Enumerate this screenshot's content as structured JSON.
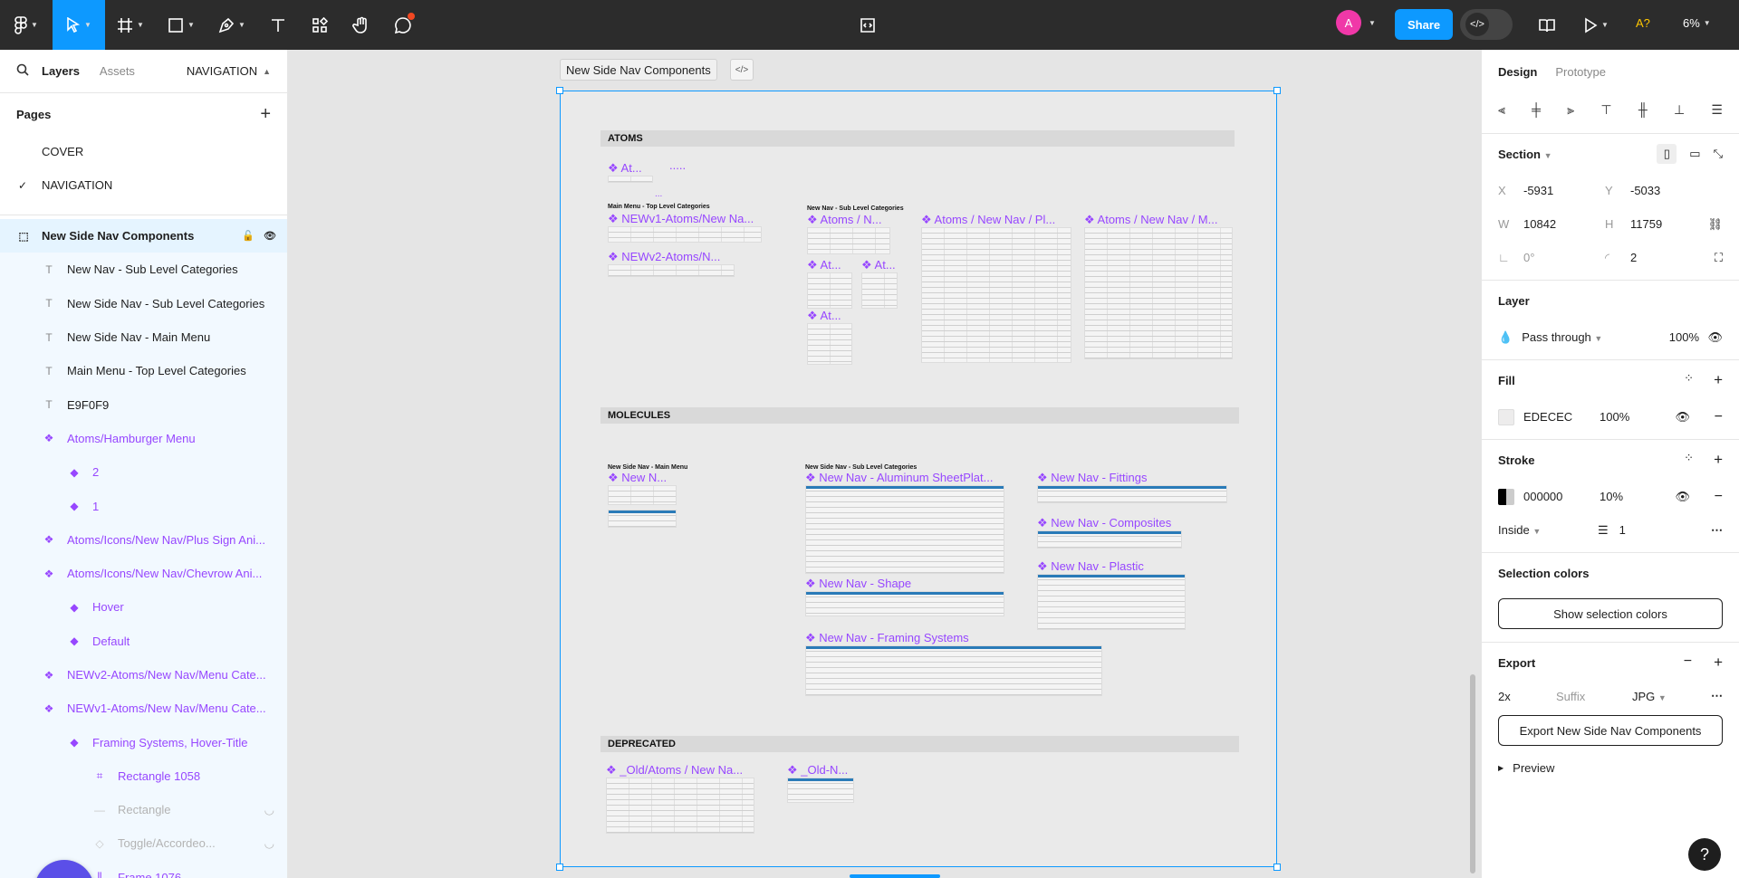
{
  "toolbar": {
    "avatar_letter": "A",
    "share_label": "Share",
    "alt_badge": "A?",
    "zoom": "6%",
    "accent": "#0d99ff"
  },
  "left_panel": {
    "tabs": {
      "layers": "Layers",
      "assets": "Assets"
    },
    "current_page_menu": "NAVIGATION",
    "pages_title": "Pages",
    "pages": [
      {
        "label": "COVER",
        "checked": false
      },
      {
        "label": "NAVIGATION",
        "checked": true
      }
    ],
    "layers": [
      {
        "label": "New Side Nav Components",
        "icon": "section",
        "indent": 0,
        "style": "selected"
      },
      {
        "label": "New Nav - Sub Level Categories",
        "icon": "text",
        "indent": 1,
        "style": "normal"
      },
      {
        "label": "New Side Nav - Sub Level Categories",
        "icon": "text",
        "indent": 1,
        "style": "normal"
      },
      {
        "label": "New Side Nav - Main Menu",
        "icon": "text",
        "indent": 1,
        "style": "normal"
      },
      {
        "label": "Main Menu - Top Level Categories",
        "icon": "text",
        "indent": 1,
        "style": "normal"
      },
      {
        "label": "E9F0F9",
        "icon": "text",
        "indent": 1,
        "style": "normal"
      },
      {
        "label": "Atoms/Hamburger Menu",
        "icon": "component",
        "indent": 1,
        "style": "purple"
      },
      {
        "label": "2",
        "icon": "variant",
        "indent": 2,
        "style": "purple"
      },
      {
        "label": "1",
        "icon": "variant",
        "indent": 2,
        "style": "purple"
      },
      {
        "label": "Atoms/Icons/New Nav/Plus Sign Ani...",
        "icon": "component",
        "indent": 1,
        "style": "purple"
      },
      {
        "label": "Atoms/Icons/New Nav/Chevrow Ani...",
        "icon": "component",
        "indent": 1,
        "style": "purple"
      },
      {
        "label": "Hover",
        "icon": "variant",
        "indent": 2,
        "style": "purple"
      },
      {
        "label": "Default",
        "icon": "variant",
        "indent": 2,
        "style": "purple"
      },
      {
        "label": "NEWv2-Atoms/New Nav/Menu Cate...",
        "icon": "component",
        "indent": 1,
        "style": "purple"
      },
      {
        "label": "NEWv1-Atoms/New Nav/Menu Cate...",
        "icon": "component",
        "indent": 1,
        "style": "purple"
      },
      {
        "label": "Framing Systems, Hover-Title",
        "icon": "variant",
        "indent": 2,
        "style": "purple"
      },
      {
        "label": "Rectangle 1058",
        "icon": "frame",
        "indent": 3,
        "style": "purple"
      },
      {
        "label": "Rectangle",
        "icon": "line",
        "indent": 3,
        "style": "faded"
      },
      {
        "label": "Toggle/Accordeo...",
        "icon": "instance",
        "indent": 3,
        "style": "faded"
      },
      {
        "label": "Frame 1076",
        "icon": "autolayout",
        "indent": 3,
        "style": "purple"
      }
    ]
  },
  "canvas": {
    "frame_label": "New Side Nav Components",
    "sections": {
      "atoms": "ATOMS",
      "molecules": "MOLECULES",
      "deprecated": "DEPRECATED"
    },
    "atoms": {
      "small_a": "❖ At...",
      "dots": ".....",
      "dots2": "...",
      "main_menu_caption": "Main Menu - Top Level Categories",
      "sub_level_caption": "New Nav - Sub Level Categories",
      "newv1": "❖ NEWv1-Atoms/New Na...",
      "newv2": "❖ NEWv2-Atoms/N...",
      "atoms_n": "❖ Atoms / N...",
      "at1": "❖ At...",
      "at2": "❖ At...",
      "at3": "❖ At...",
      "atoms_pl": "❖ Atoms / New Nav / Pl...",
      "atoms_m": "❖ Atoms / New Nav / M..."
    },
    "molecules": {
      "main_menu_caption": "New Side Nav - Main Menu",
      "sub_caption": "New Side Nav - Sub Level Categories",
      "new_n": "❖ New N...",
      "aluminum": "❖ New Nav - Aluminum SheetPlat...",
      "fittings": "❖ New Nav - Fittings",
      "composites": "❖ New Nav - Composites",
      "plastic": "❖ New Nav - Plastic",
      "shape": "❖ New Nav - Shape",
      "framing": "❖ New Nav - Framing Systems"
    },
    "deprecated": {
      "old_atoms": "❖ _Old/Atoms / New Na...",
      "old_n": "❖ _Old-N..."
    }
  },
  "right_panel": {
    "tabs": {
      "design": "Design",
      "prototype": "Prototype"
    },
    "section_title": "Section",
    "x_label": "X",
    "x": "-5931",
    "y_label": "Y",
    "y": "-5033",
    "w_label": "W",
    "w": "10842",
    "h_label": "H",
    "h": "11759",
    "rotation": "0°",
    "radius": "2",
    "layer_title": "Layer",
    "blend": "Pass through",
    "opacity": "100%",
    "fill_title": "Fill",
    "fill_hex": "EDECEC",
    "fill_color": "#edecec",
    "fill_opacity": "100%",
    "stroke_title": "Stroke",
    "stroke_hex": "000000",
    "stroke_opacity": "10%",
    "stroke_position": "Inside",
    "stroke_weight": "1",
    "selection_colors_title": "Selection colors",
    "show_selection_colors": "Show selection colors",
    "export_title": "Export",
    "export_scale": "2x",
    "export_suffix_placeholder": "Suffix",
    "export_format": "JPG",
    "export_button": "Export New Side Nav Components",
    "preview": "Preview",
    "help": "?"
  }
}
